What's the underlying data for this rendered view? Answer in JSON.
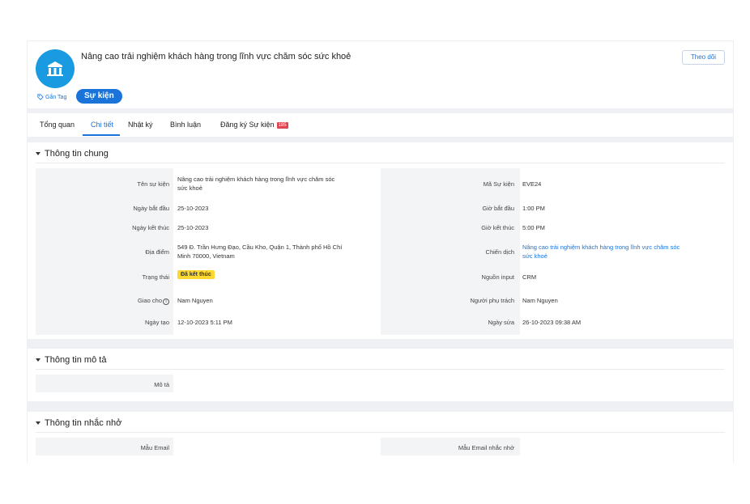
{
  "header": {
    "title": "Nâng cao trải nghiệm khách hàng trong lĩnh vực chăm sóc sức khoẻ",
    "follow_label": "Theo dõi",
    "tag_label": "Gắn Tag",
    "type_badge": "Sự kiện"
  },
  "tabs": [
    {
      "label": "Tổng quan",
      "active": false
    },
    {
      "label": "Chi tiết",
      "active": true
    },
    {
      "label": "Nhật ký",
      "active": false
    },
    {
      "label": "Bình luận",
      "active": false
    },
    {
      "label": "Đăng ký Sự kiện",
      "count": "185",
      "active": false
    }
  ],
  "general": {
    "title": "Thông tin chung",
    "event_name_label": "Tên sự kiện",
    "event_name_line1": "Nâng cao trải nghiệm khách hàng trong lĩnh vực chăm sóc",
    "event_name_line2": "sức khoẻ",
    "event_code_label": "Mã Sự kiện",
    "event_code": "EVE24",
    "start_date_label": "Ngày bắt đầu",
    "start_date": "25-10-2023",
    "start_time_label": "Giờ bắt đầu",
    "start_time": "1:00 PM",
    "end_date_label": "Ngày kết thúc",
    "end_date": "25-10-2023",
    "end_time_label": "Giờ kết thúc",
    "end_time": "5:00 PM",
    "location_label": "Địa điểm",
    "location_line1": "549 Đ. Trần Hưng Đạo, Cầu Kho, Quận 1, Thành phố Hồ Chí",
    "location_line2": "Minh 70000, Vietnam",
    "campaign_label": "Chiến dịch",
    "campaign_line1": "Nâng cao trải nghiệm khách hàng trong lĩnh vực chăm sóc",
    "campaign_line2": "sức khoẻ",
    "status_label": "Trạng thái",
    "status": "Đã kết thúc",
    "source_label": "Nguồn input",
    "source": "CRM",
    "assignee_label": "Giao cho",
    "assignee": "Nam Nguyen",
    "owner_label": "Người phụ trách",
    "owner": "Nam Nguyen",
    "created_label": "Ngày tạo",
    "created": "12-10-2023 5:11 PM",
    "modified_label": "Ngày sửa",
    "modified": "26-10-2023 09:38 AM"
  },
  "description": {
    "title": "Thông tin mô tả",
    "desc_label": "Mô tả"
  },
  "reminder": {
    "title": "Thông tin nhắc nhở",
    "email_template_label": "Mẫu Email",
    "reminder_template_label": "Mẫu Email nhắc nhở"
  },
  "colors": {
    "accent": "#1a73d9",
    "logo_bg": "#1a9ae0",
    "status_bg": "#fcd831",
    "count_bg": "#e0454f"
  }
}
